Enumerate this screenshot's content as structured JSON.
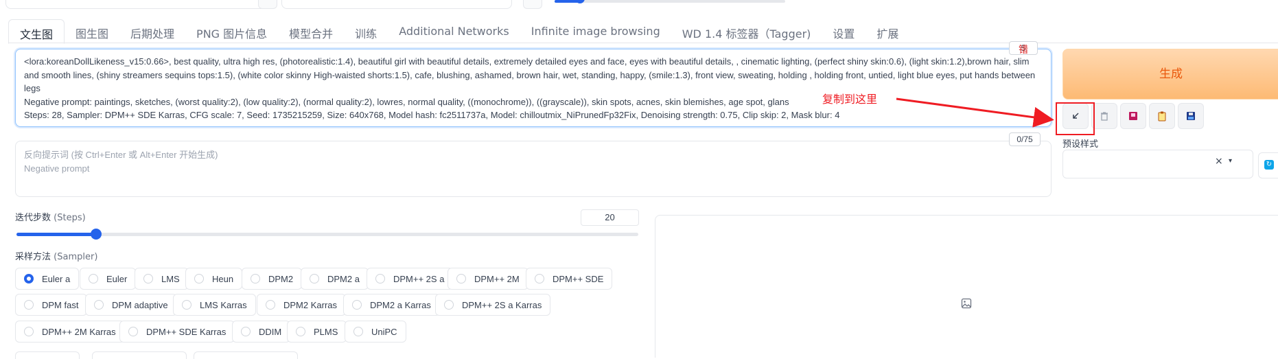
{
  "tabs": [
    "文生图",
    "图生图",
    "后期处理",
    "PNG 图片信息",
    "模型合并",
    "训练",
    "Additional Networks",
    "Infinite image browsing",
    "WD 1.4 标签器（Tagger)",
    "设置",
    "扩展"
  ],
  "prompt": {
    "line1": "<lora:koreanDollLikeness_v15:0.66>, best quality, ultra high res, (photorealistic:1.4), beautiful girl with beautiful details, extremely detailed eyes and face, eyes with beautiful details, , cinematic lighting, (perfect shiny skin:0.6), (light skin:1.2),brown hair, slim and smooth lines, (shiny streamers sequins tops:1.5), (white color skinny High-waisted shorts:1.5), cafe, blushing, ashamed, brown hair, wet, standing, happy, (smile:1.3), front view, sweating, holding , holding front, untied, light blue eyes, put hands between legs",
    "line2": "Negative prompt: paintings, sketches, (worst quality:2), (low quality:2), (normal quality:2), lowres, normal quality, ((monochrome)), ((grayscale)), skin spots, acnes, skin blemishes, age spot, glans",
    "line3": "Steps: 28, Sampler: DPM++ SDE Karras, CFG scale: 7, Seed: 1735215259, Size: 640x768, Model hash: fc2511737a, Model: chilloutmix_NiPrunedFp32Fix, Denoising strength: 0.75, Clip skip: 2, Mask blur: 4",
    "counter": "5",
    "error_badge": "错"
  },
  "negative": {
    "placeholder_cn": "反向提示词 (按 Ctrl+Enter 或 Alt+Enter 开始生成)",
    "placeholder_en": "Negative prompt",
    "counter": "0/75"
  },
  "generate_label": "生成",
  "tool_icons": [
    "arrow-paste-icon",
    "trash-icon",
    "extra-networks-icon",
    "clipboard-icon",
    "save-style-icon"
  ],
  "preset": {
    "label": "预设样式",
    "clear": "×",
    "caret": "▾"
  },
  "annotation": "复制到这里",
  "steps": {
    "label_cn": "迭代步数",
    "label_en": "(Steps)",
    "value": "20",
    "min": 1,
    "max": 150
  },
  "sampler": {
    "label_cn": "采样方法",
    "label_en": "(Sampler)",
    "selected": "Euler a",
    "rows": [
      [
        "Euler a",
        "Euler",
        "LMS",
        "Heun",
        "DPM2",
        "DPM2 a",
        "DPM++ 2S a",
        "DPM++ 2M",
        "DPM++ SDE"
      ],
      [
        "DPM fast",
        "DPM adaptive",
        "LMS Karras",
        "DPM2 Karras",
        "DPM2 a Karras",
        "DPM++ 2S a Karras"
      ],
      [
        "DPM++ 2M Karras",
        "DPM++ SDE Karras",
        "DDIM",
        "PLMS",
        "UniPC"
      ]
    ]
  },
  "colors": {
    "accent": "#2563eb",
    "generate_text": "#ea580c",
    "annotation": "#ef1c23"
  }
}
